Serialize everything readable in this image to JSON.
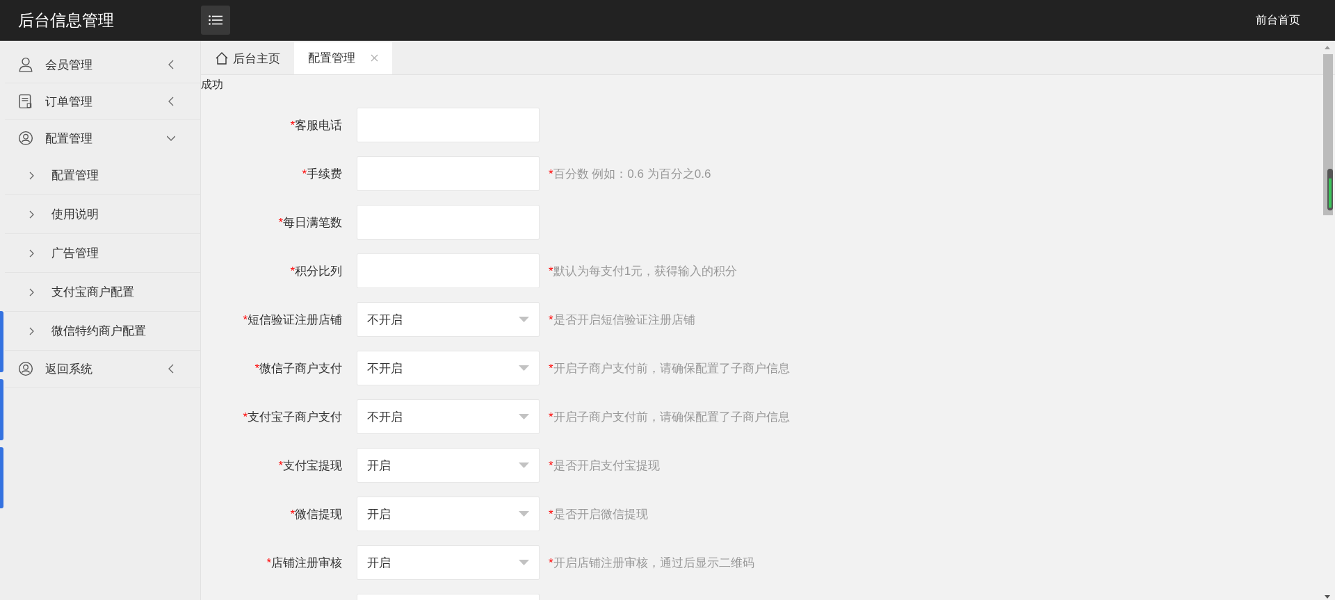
{
  "header": {
    "title": "后台信息管理",
    "right_link": "前台首页"
  },
  "sidebar": {
    "items": [
      {
        "label": "会员管理",
        "expanded": false
      },
      {
        "label": "订单管理",
        "expanded": false
      },
      {
        "label": "配置管理",
        "expanded": true,
        "children": [
          {
            "label": "配置管理"
          },
          {
            "label": "使用说明"
          },
          {
            "label": "广告管理"
          },
          {
            "label": "支付宝商户配置"
          },
          {
            "label": "微信特约商户配置"
          }
        ]
      },
      {
        "label": "返回系统",
        "expanded": false
      }
    ]
  },
  "tabs": [
    {
      "label": "后台主页",
      "kind": "home",
      "selected": false
    },
    {
      "label": "配置管理",
      "kind": "closable",
      "selected": true
    }
  ],
  "message": "成功",
  "form": {
    "rows": [
      {
        "kind": "input",
        "mark": "*",
        "label": "客服电话"
      },
      {
        "kind": "input",
        "mark": "*",
        "label": "手续费",
        "hint_mark": "*",
        "hint": "百分数 例如：0.6 为百分之0.6"
      },
      {
        "kind": "input",
        "mark": "*",
        "label": "每日满笔数"
      },
      {
        "kind": "input",
        "mark": "*",
        "label": "积分比列",
        "hint_mark": "*",
        "hint": "默认为每支付1元，获得输入的积分"
      },
      {
        "kind": "select",
        "mark": "*",
        "label": "短信验证注册店铺",
        "value": "不开启",
        "hint_mark": "*",
        "hint": "是否开启短信验证注册店铺"
      },
      {
        "kind": "select",
        "mark": "*",
        "label": "微信子商户支付",
        "value": "不开启",
        "hint_mark": "*",
        "hint": "开启子商户支付前，请确保配置了子商户信息"
      },
      {
        "kind": "select",
        "mark": "*",
        "label": "支付宝子商户支付",
        "value": "不开启",
        "hint_mark": "*",
        "hint": "开启子商户支付前，请确保配置了子商户信息"
      },
      {
        "kind": "select",
        "mark": "*",
        "label": "支付宝提现",
        "value": "开启",
        "hint_mark": "*",
        "hint": "是否开启支付宝提现"
      },
      {
        "kind": "select",
        "mark": "*",
        "label": "微信提现",
        "value": "开启",
        "hint_mark": "*",
        "hint": "是否开启微信提现"
      },
      {
        "kind": "select",
        "mark": "*",
        "label": "店铺注册审核",
        "value": "开启",
        "hint_mark": "*",
        "hint": "开启店铺注册审核，通过后显示二维码"
      },
      {
        "kind": "select"
      }
    ]
  }
}
